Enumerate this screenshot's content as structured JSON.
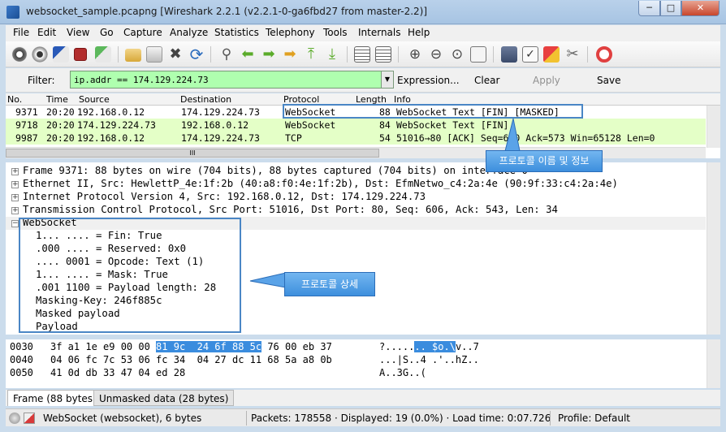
{
  "window": {
    "title": "websocket_sample.pcapng [Wireshark 2.2.1 (v2.2.1-0-ga6fbd27 from master-2.2)]",
    "min": "─",
    "max": "□",
    "close": "✕"
  },
  "menu": [
    "File",
    "Edit",
    "View",
    "Go",
    "Capture",
    "Analyze",
    "Statistics",
    "Telephony",
    "Tools",
    "Internals",
    "Help"
  ],
  "filter": {
    "label": "Filter:",
    "value": "ip.addr == 174.129.224.73",
    "dropdown": "▼",
    "buttons": [
      "Expression...",
      "Clear",
      "Apply",
      "Save"
    ]
  },
  "packet_list": {
    "columns": [
      "No.",
      "Time",
      "Source",
      "Destination",
      "Protocol",
      "Length",
      "Info"
    ],
    "rows": [
      {
        "no": "9371",
        "time": "20:20",
        "source": "192.168.0.12",
        "destination": "174.129.224.73",
        "protocol": "WebSocket",
        "length": "88",
        "info": "WebSocket Text [FIN] [MASKED]",
        "color": "#ffffff"
      },
      {
        "no": "9718",
        "time": "20:20",
        "source": "174.129.224.73",
        "destination": "192.168.0.12",
        "protocol": "WebSocket",
        "length": "84",
        "info": "WebSocket Text [FIN]",
        "color": "#e4ffc7"
      },
      {
        "no": "9987",
        "time": "20:20",
        "source": "192.168.0.12",
        "destination": "174.129.224.73",
        "protocol": "TCP",
        "length": "54",
        "info": "51016→80 [ACK] Seq=640 Ack=573 Win=65128 Len=0",
        "color": "#e4ffc7"
      }
    ],
    "h_scroll_grip": "III"
  },
  "details": [
    {
      "text": "Frame 9371: 88 bytes on wire (704 bits), 88 bytes captured (704 bits) on interface 0",
      "expander": "+"
    },
    {
      "text": "Ethernet II, Src: HewlettP_4e:1f:2b (40:a8:f0:4e:1f:2b), Dst: EfmNetwo_c4:2a:4e (90:9f:33:c4:2a:4e)",
      "expander": "+"
    },
    {
      "text": "Internet Protocol Version 4, Src: 192.168.0.12, Dst: 174.129.224.73",
      "expander": "+"
    },
    {
      "text": "Transmission Control Protocol, Src Port: 51016, Dst Port: 80, Seq: 606, Ack: 543, Len: 34",
      "expander": "+"
    },
    {
      "text": "WebSocket",
      "expander": "−"
    }
  ],
  "ws_fields": [
    "1... .... = Fin: True",
    ".000 .... = Reserved: 0x0",
    ".... 0001 = Opcode: Text (1)",
    "1... .... = Mask: True",
    ".001 1100 = Payload length: 28",
    "Masking-Key: 246f885c",
    "Masked payload",
    "Payload"
  ],
  "hex": [
    {
      "offset": "0030",
      "pre": "3f a1 1e e9 00 00 ",
      "hl": "81 9c  24 6f 88 5c",
      "post": " 76 00 eb 37",
      "ascii_pre": "?.....",
      "ascii_hl": ".. $o.\\",
      "ascii_post": "v..7"
    },
    {
      "offset": "0040",
      "pre": "04 06 fc 7c 53 06 fc 34  04 27 dc 11 68 5a a8 0b",
      "hl": "",
      "post": "",
      "ascii_pre": "...|S..4 .'..hZ..",
      "ascii_hl": "",
      "ascii_post": ""
    },
    {
      "offset": "0050",
      "pre": "41 0d db 33 47 04 ed 28",
      "hl": "",
      "post": "",
      "ascii_pre": "A..3G..(",
      "ascii_hl": "",
      "ascii_post": ""
    }
  ],
  "tabs": [
    "Frame (88 bytes)",
    "Unmasked data (28 bytes)"
  ],
  "status": {
    "field": "WebSocket (websocket), 6 bytes",
    "packets": "Packets: 178558 · Displayed: 19 (0.0%) · Load time: 0:07.726",
    "profile": "Profile: Default"
  },
  "callouts": {
    "protocol_info": "프로토콜 이름 및 정보",
    "protocol_detail": "프로토콜 상세"
  }
}
